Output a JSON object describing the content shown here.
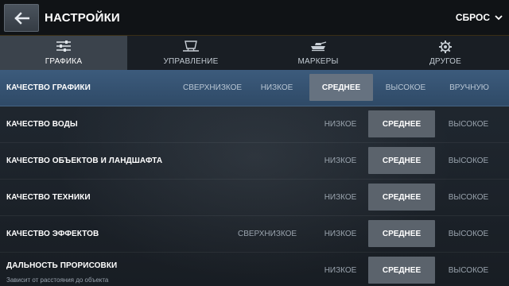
{
  "header": {
    "title": "НАСТРОЙКИ",
    "reset_label": "СБРОС"
  },
  "tabs": [
    {
      "label": "ГРАФИКА",
      "icon": "sliders-icon",
      "active": true
    },
    {
      "label": "УПРАВЛЕНИЕ",
      "icon": "monitor-icon",
      "active": false
    },
    {
      "label": "МАРКЕРЫ",
      "icon": "tank-icon",
      "active": false
    },
    {
      "label": "ДРУГОЕ",
      "icon": "gear-icon",
      "active": false
    }
  ],
  "rows": [
    {
      "label": "КАЧЕСТВО ГРАФИКИ",
      "sub": "",
      "options": [
        "СВЕРХНИЗКОЕ",
        "НИЗКОЕ",
        "СРЕДНЕЕ",
        "ВЫСОКОЕ",
        "ВРУЧНУЮ"
      ],
      "selected": "СРЕДНЕЕ"
    },
    {
      "label": "КАЧЕСТВО ВОДЫ",
      "sub": "",
      "options": [
        "НИЗКОЕ",
        "СРЕДНЕЕ",
        "ВЫСОКОЕ"
      ],
      "selected": "СРЕДНЕЕ"
    },
    {
      "label": "КАЧЕСТВО ОБЪЕКТОВ И ЛАНДШАФТА",
      "sub": "",
      "options": [
        "НИЗКОЕ",
        "СРЕДНЕЕ",
        "ВЫСОКОЕ"
      ],
      "selected": "СРЕДНЕЕ"
    },
    {
      "label": "КАЧЕСТВО ТЕХНИКИ",
      "sub": "",
      "options": [
        "НИЗКОЕ",
        "СРЕДНЕЕ",
        "ВЫСОКОЕ"
      ],
      "selected": "СРЕДНЕЕ"
    },
    {
      "label": "КАЧЕСТВО ЭФФЕКТОВ",
      "sub": "",
      "options": [
        "СВЕРХНИЗКОЕ",
        "НИЗКОЕ",
        "СРЕДНЕЕ",
        "ВЫСОКОЕ"
      ],
      "selected": "СРЕДНЕЕ"
    },
    {
      "label": "ДАЛЬНОСТЬ ПРОРИСОВКИ",
      "sub": "Зависит от расстояния до объекта",
      "options": [
        "НИЗКОЕ",
        "СРЕДНЕЕ",
        "ВЫСОКОЕ"
      ],
      "selected": "СРЕДНЕЕ"
    }
  ],
  "colors": {
    "header_bg": "#101316",
    "active_row": "#3c5b7c",
    "selected_option": "#5b636c"
  }
}
